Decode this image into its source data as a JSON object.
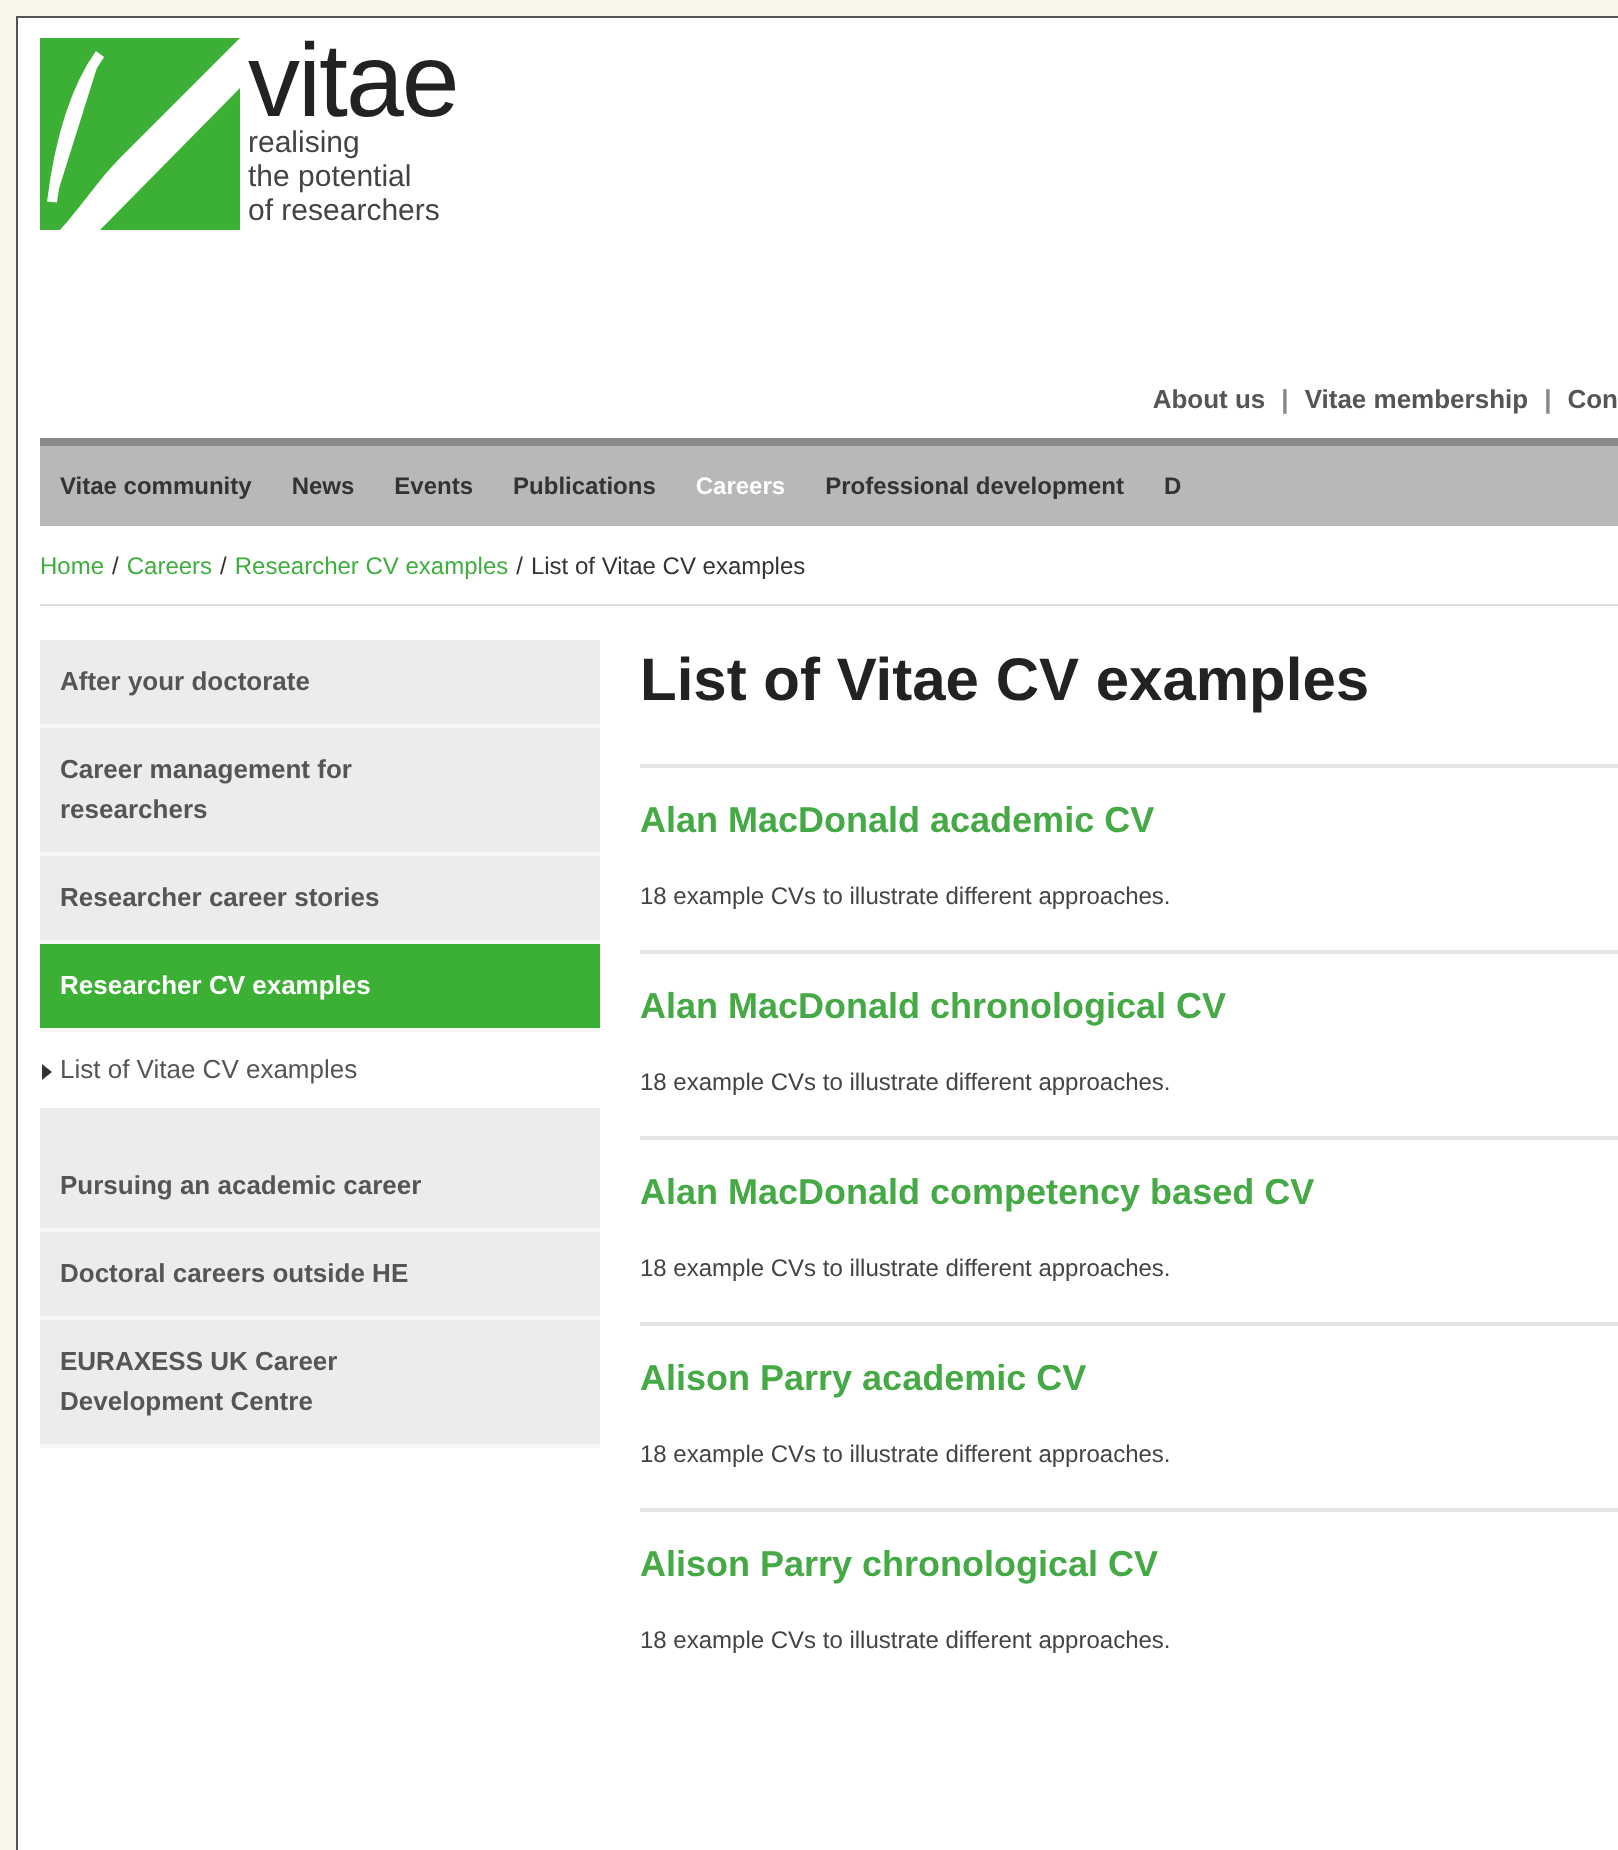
{
  "logo": {
    "wordmark": "vitae",
    "tagline": [
      "realising",
      "the potential",
      "of researchers"
    ]
  },
  "top_links": [
    "About us",
    "Vitae membership",
    "Con"
  ],
  "top_links_separator": "|",
  "breadcrumb_separator": "/",
  "nav": [
    {
      "label": "Vitae community",
      "selected": false
    },
    {
      "label": "News",
      "selected": false
    },
    {
      "label": "Events",
      "selected": false
    },
    {
      "label": "Publications",
      "selected": false
    },
    {
      "label": "Careers",
      "selected": true
    },
    {
      "label": "Professional development",
      "selected": false
    },
    {
      "label": "D",
      "selected": false
    }
  ],
  "breadcrumb": [
    {
      "label": "Home",
      "kind": "link"
    },
    {
      "label": "Careers",
      "kind": "link"
    },
    {
      "label": "Researcher CV examples",
      "kind": "link"
    },
    {
      "label": "List of Vitae CV examples",
      "kind": "current"
    }
  ],
  "sidebar": [
    {
      "label": "After your doctorate",
      "kind": "section",
      "selected": false
    },
    {
      "label": "Career management for researchers",
      "kind": "section",
      "selected": false
    },
    {
      "label": "Researcher career stories",
      "kind": "section",
      "selected": false
    },
    {
      "label": "Researcher CV examples",
      "kind": "section",
      "selected": true
    },
    {
      "label": "List of Vitae CV examples",
      "kind": "sub",
      "selected": false
    },
    {
      "label": "Pursuing an academic career",
      "kind": "section",
      "selected": false
    },
    {
      "label": "Doctoral careers outside HE",
      "kind": "section",
      "selected": false
    },
    {
      "label": "EURAXESS UK Career Development Centre",
      "kind": "section",
      "selected": false
    }
  ],
  "heading": "List of Vitae CV examples",
  "entries": [
    {
      "title": "Alan MacDonald academic CV",
      "summary": "18 example CVs to illustrate different approaches."
    },
    {
      "title": "Alan MacDonald chronological CV",
      "summary": "18 example CVs to illustrate different approaches."
    },
    {
      "title": "Alan MacDonald competency based CV",
      "summary": "18 example CVs to illustrate different approaches."
    },
    {
      "title": "Alison Parry academic CV",
      "summary": "18 example CVs to illustrate different approaches."
    },
    {
      "title": "Alison Parry chronological CV",
      "summary": "18 example CVs to illustrate different approaches."
    }
  ]
}
